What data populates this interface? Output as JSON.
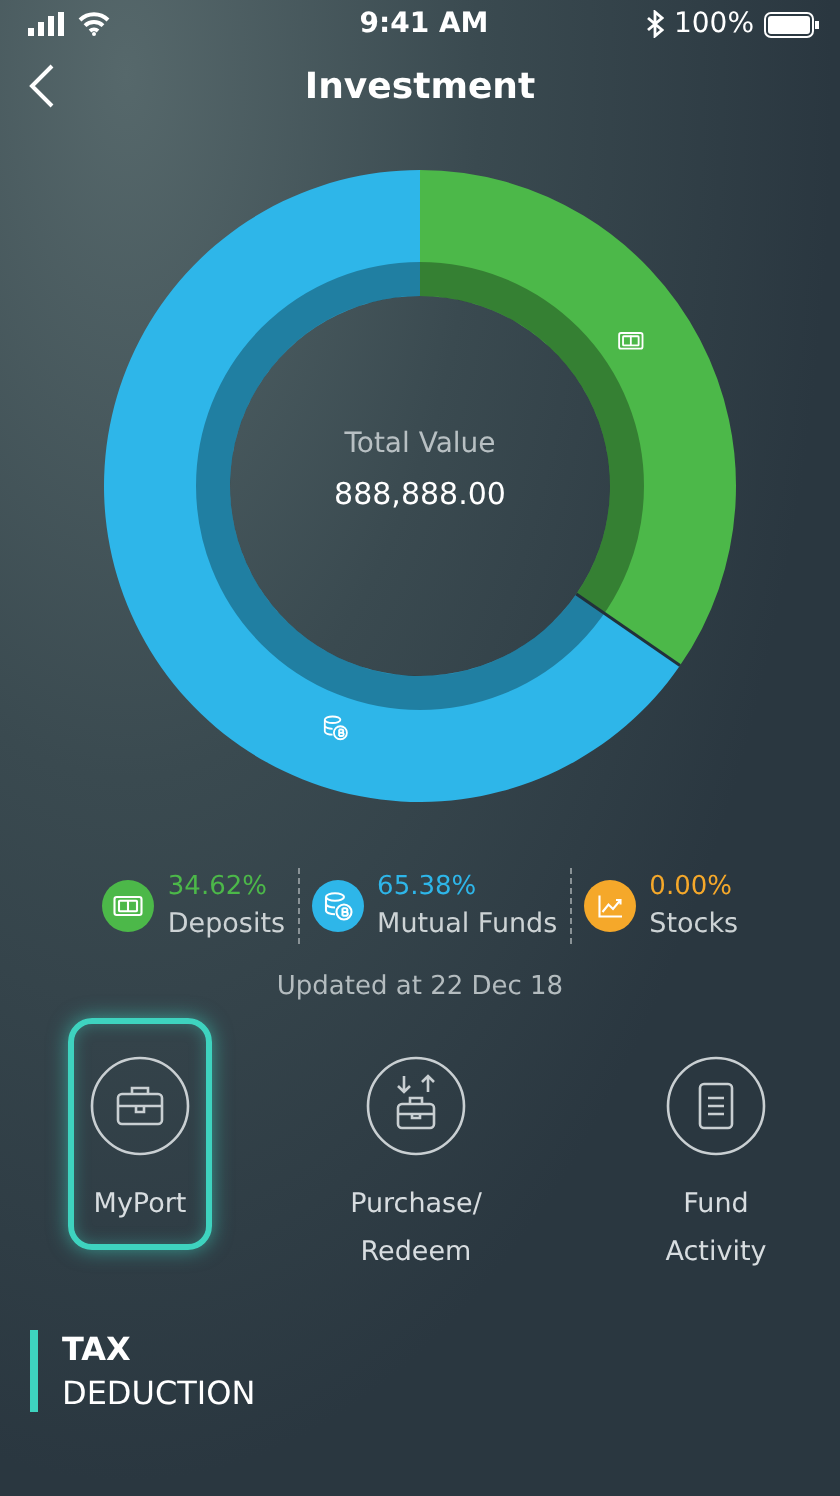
{
  "status_bar": {
    "time": "9:41 AM",
    "battery": "100%"
  },
  "header": {
    "title": "Investment"
  },
  "chart": {
    "center_label": "Total Value",
    "center_value": "888,888.00",
    "chart_data": {
      "type": "donut",
      "categories": [
        "Deposits",
        "Mutual Funds",
        "Stocks"
      ],
      "values": [
        34.62,
        65.38,
        0
      ]
    }
  },
  "legend": [
    {
      "kind": "deposits",
      "percent": "34.62%",
      "color": "#4cb849"
    },
    {
      "kind": "funds",
      "percent": "65.38%",
      "color": "#2eb6e9"
    },
    {
      "kind": "stocks",
      "percent": "0.00%",
      "color": "#f5a82a"
    }
  ],
  "updated": "Updated at 22 Dec 18",
  "actions": [
    {
      "kind": "portfolio",
      "label": "MyPort",
      "selected": true
    },
    {
      "kind": "transfer",
      "label": "Purchase/ Redeem",
      "selected": false
    },
    {
      "kind": "document",
      "label": "Fund Activity",
      "selected": false
    }
  ],
  "section": {
    "title": "TAX",
    "subtitle": "DEDUCTION"
  }
}
